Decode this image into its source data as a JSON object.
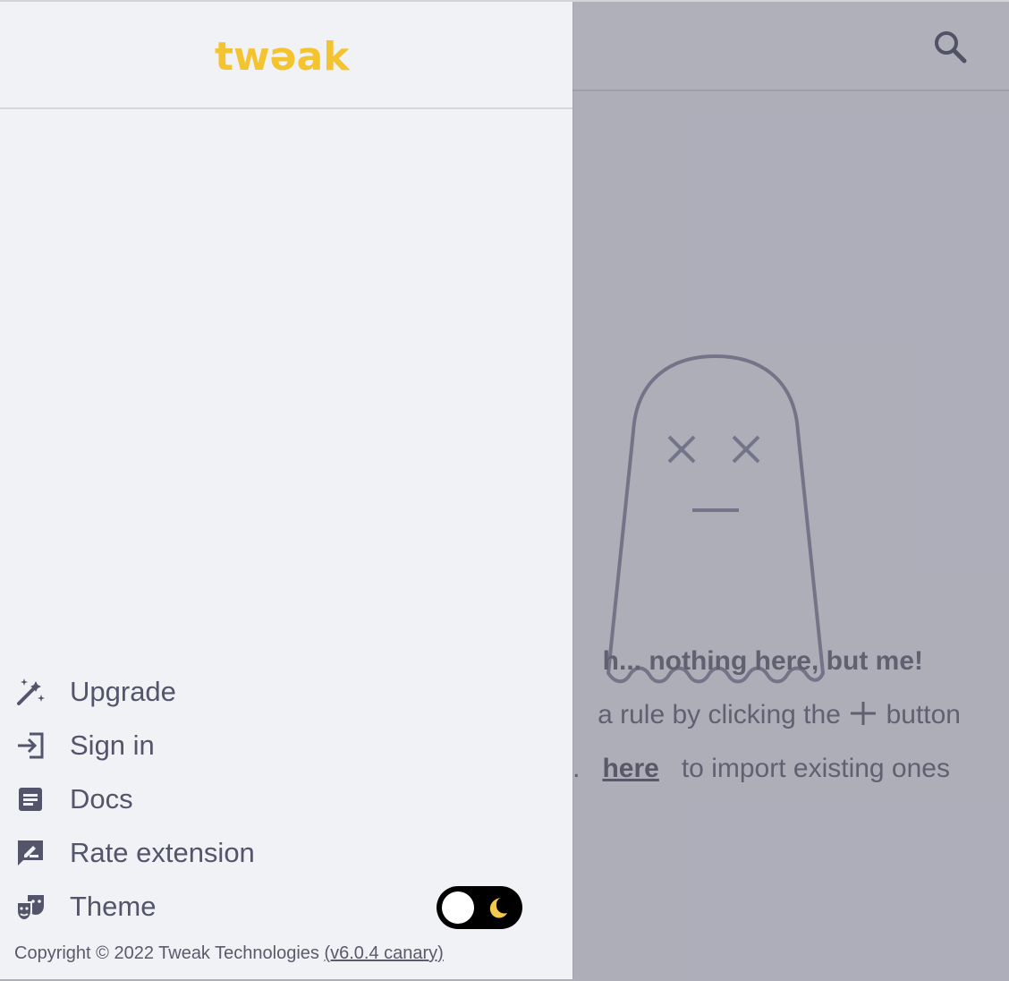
{
  "app": {
    "logo_text": "twәak"
  },
  "main": {
    "empty_state": {
      "title": "h... nothing here, but me!",
      "line1_prefix": "a rule by clicking the",
      "line1_icon": "plus",
      "line1_suffix": "button",
      "line2_prefix": ".",
      "line2_link": "here",
      "line2_suffix": "to import existing ones"
    }
  },
  "drawer": {
    "menu": [
      {
        "label": "Upgrade",
        "icon": "magic-wand-icon"
      },
      {
        "label": "Sign in",
        "icon": "login-icon"
      },
      {
        "label": "Docs",
        "icon": "document-icon"
      },
      {
        "label": "Rate extension",
        "icon": "rate-review-icon"
      },
      {
        "label": "Theme",
        "icon": "theater-masks-icon"
      }
    ],
    "theme_toggle": {
      "mode": "dark",
      "icon": "moon-icon"
    },
    "copyright_text": "Copyright © 2022 Tweak Technologies",
    "version_text": "(v6.0.4 canary)"
  },
  "colors": {
    "logo_yellow": "#f4c430",
    "logo_orange": "#f2a23c",
    "moon_yellow": "#f2c94c",
    "text_muted": "#54546a"
  }
}
